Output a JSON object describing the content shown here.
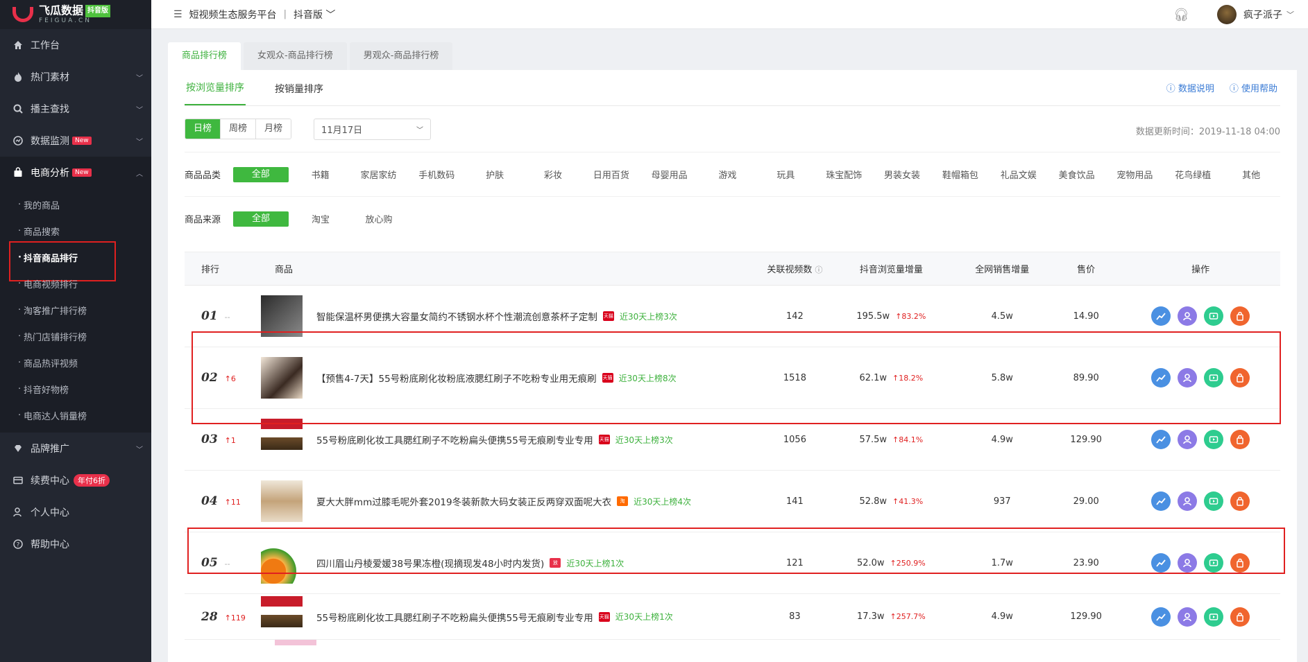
{
  "brand": {
    "name": "飞瓜数据",
    "badge": "抖音版",
    "sub": "FEIGUA.CN"
  },
  "topbar": {
    "platform": "短视频生态服务平台",
    "separator": "|",
    "version": "抖音版",
    "user": "疯子派子"
  },
  "sidebar": {
    "items": [
      {
        "label": "工作台",
        "icon": "home-icon",
        "chevron": false
      },
      {
        "label": "热门素材",
        "icon": "flame-icon",
        "chevron": true
      },
      {
        "label": "播主查找",
        "icon": "search-icon",
        "chevron": true
      },
      {
        "label": "数据监测",
        "icon": "monitor-icon",
        "chevron": true,
        "badge": "New"
      },
      {
        "label": "电商分析",
        "icon": "bag-icon",
        "chevron": true,
        "badge": "New",
        "expanded": true
      }
    ],
    "sub_items": [
      "我的商品",
      "商品搜索",
      "抖音商品排行",
      "电商视频排行",
      "淘客推广排行榜",
      "热门店铺排行榜",
      "商品热评视频",
      "抖音好物榜",
      "电商达人销量榜"
    ],
    "bottom_items": [
      {
        "label": "品牌推广",
        "icon": "diamond-icon",
        "chevron": true
      },
      {
        "label": "续费中心",
        "icon": "card-icon",
        "badge": "年付6折"
      },
      {
        "label": "个人中心",
        "icon": "user-icon"
      },
      {
        "label": "帮助中心",
        "icon": "help-icon"
      }
    ]
  },
  "tabs": [
    "商品排行榜",
    "女观众-商品排行榜",
    "男观众-商品排行榜"
  ],
  "subtabs": [
    "按浏览量排序",
    "按销量排序"
  ],
  "help_links": [
    "数据说明",
    "使用帮助"
  ],
  "period": [
    "日榜",
    "周榜",
    "月榜"
  ],
  "date": "11月17日",
  "update_time": "数据更新时间：2019-11-18 04:00",
  "category": {
    "label": "商品品类",
    "items": [
      "全部",
      "书籍",
      "家居家纺",
      "手机数码",
      "护肤",
      "彩妆",
      "日用百货",
      "母婴用品",
      "游戏",
      "玩具",
      "珠宝配饰",
      "男装女装",
      "鞋帽箱包",
      "礼品文娱",
      "美食饮品",
      "宠物用品",
      "花鸟绿植",
      "其他"
    ]
  },
  "source": {
    "label": "商品来源",
    "items": [
      "全部",
      "淘宝",
      "放心购"
    ]
  },
  "table": {
    "headers": [
      "排行",
      "商品",
      "关联视频数",
      "抖音浏览量增量",
      "全网销售增量",
      "售价",
      "操作"
    ],
    "rows": [
      {
        "rank": "01",
        "change": "--",
        "title": "智能保温杯男便携大容量女简约不锈钢水杯个性潮流创意茶杯子定制",
        "shop": "tmall",
        "hit": "近30天上榜3次",
        "videos": "142",
        "views": "195.5w",
        "growth": "↑83.2%",
        "sales": "4.5w",
        "price": "14.90"
      },
      {
        "rank": "02",
        "change": "↑6",
        "title": "【预售4-7天】55号粉底刷化妆粉底液腮红刷子不吃粉专业用无痕刷",
        "shop": "tmall",
        "hit": "近30天上榜8次",
        "videos": "1518",
        "views": "62.1w",
        "growth": "↑18.2%",
        "sales": "5.8w",
        "price": "89.90"
      },
      {
        "rank": "03",
        "change": "↑1",
        "title": "55号粉底刷化妆工具腮红刷子不吃粉扁头便携55号无痕刷专业专用",
        "shop": "tmall",
        "hit": "近30天上榜3次",
        "videos": "1056",
        "views": "57.5w",
        "growth": "↑84.1%",
        "sales": "4.9w",
        "price": "129.90"
      },
      {
        "rank": "04",
        "change": "↑11",
        "title": "夏大大胖mm过膝毛呢外套2019冬装新款大码女装正反两穿双面呢大衣",
        "shop": "taobao",
        "hit": "近30天上榜4次",
        "videos": "141",
        "views": "52.8w",
        "growth": "↑41.3%",
        "sales": "937",
        "price": "29.00"
      },
      {
        "rank": "05",
        "change": "--",
        "title": "四川眉山丹棱爱媛38号果冻橙(现摘现发48小时内发货)",
        "shop": "fxg",
        "hit": "近30天上榜1次",
        "videos": "121",
        "views": "52.0w",
        "growth": "↑250.9%",
        "sales": "1.7w",
        "price": "23.90"
      },
      {
        "rank": "28",
        "change": "↑119",
        "title": "55号粉底刷化妆工具腮红刷子不吃粉扁头便携55号无痕刷专业专用",
        "shop": "tmall",
        "hit": "近30天上榜1次",
        "videos": "83",
        "views": "17.3w",
        "growth": "↑257.7%",
        "sales": "4.9w",
        "price": "129.90"
      }
    ]
  },
  "shop_tags": {
    "tmall": "天猫",
    "taobao": "淘",
    "fxg": "放"
  },
  "colors": {
    "accent": "#3fb83f",
    "sidebar": "#232731",
    "highlight": "#e02020"
  }
}
